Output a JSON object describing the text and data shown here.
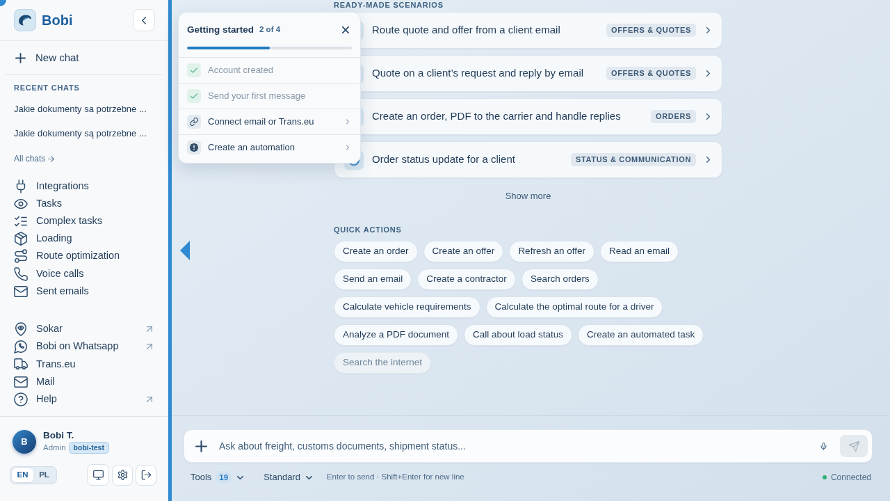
{
  "sidebar": {
    "brand": "Bobi",
    "new_chat": "New chat",
    "recent_heading": "RECENT CHATS",
    "recent_chats": [
      "Jakie dokumenty sa potrzebne ...",
      "Jakie dokumenty są potrzebne ..."
    ],
    "all_chats": "All chats",
    "nav": [
      {
        "label": "Integrations"
      },
      {
        "label": "Tasks"
      },
      {
        "label": "Complex tasks"
      },
      {
        "label": "Loading"
      },
      {
        "label": "Route optimization"
      },
      {
        "label": "Voice calls"
      },
      {
        "label": "Sent emails"
      }
    ],
    "links": [
      {
        "label": "Sokar",
        "external": true
      },
      {
        "label": "Bobi on Whatsapp",
        "external": true
      },
      {
        "label": "Trans.eu",
        "external": false
      },
      {
        "label": "Mail",
        "external": false
      },
      {
        "label": "Help",
        "external": true
      }
    ],
    "user": {
      "initial": "B",
      "name": "Bobi T.",
      "role": "Admin",
      "workspace": "bobi-test"
    },
    "languages": [
      {
        "label": "EN",
        "selected": true
      },
      {
        "label": "PL",
        "selected": false
      }
    ]
  },
  "onboarding": {
    "title": "Getting started",
    "progress": "2 of 4",
    "level": 0.5,
    "steps": [
      {
        "label": "Account created",
        "done": true
      },
      {
        "label": "Send your first message",
        "done": true
      },
      {
        "label": "Connect email or Trans.eu",
        "done": false
      },
      {
        "label": "Create an automation",
        "done": false
      }
    ]
  },
  "scenarios": {
    "heading": "READY-MADE SCENARIOS",
    "items": [
      {
        "title": "Route quote and offer from a client email",
        "tag": "OFFERS & QUOTES"
      },
      {
        "title": "Quote on a client’s request and reply by email",
        "tag": "OFFERS & QUOTES"
      },
      {
        "title": "Create an order, PDF to the carrier and handle replies",
        "tag": "ORDERS"
      },
      {
        "title": "Order status update for a client",
        "tag": "STATUS & COMMUNICATION"
      }
    ],
    "show_more": "Show more"
  },
  "quick_actions": {
    "heading": "QUICK ACTIONS",
    "items": [
      {
        "label": "Create an order",
        "disabled": false
      },
      {
        "label": "Create an offer",
        "disabled": false
      },
      {
        "label": "Refresh an offer",
        "disabled": false
      },
      {
        "label": "Read an email",
        "disabled": false
      },
      {
        "label": "Send an email",
        "disabled": false
      },
      {
        "label": "Create a contractor",
        "disabled": false
      },
      {
        "label": "Search orders",
        "disabled": false
      },
      {
        "label": "Calculate vehicle requirements",
        "disabled": false
      },
      {
        "label": "Calculate the optimal route for a driver",
        "disabled": false
      },
      {
        "label": "Analyze a PDF document",
        "disabled": false
      },
      {
        "label": "Call about load status",
        "disabled": false
      },
      {
        "label": "Create an automated task",
        "disabled": false
      },
      {
        "label": "Search the internet",
        "disabled": true
      }
    ]
  },
  "composer": {
    "placeholder": "Ask about freight, customs documents, shipment status...",
    "tools": "Tools",
    "tools_count": "19",
    "mode": "Standard",
    "hint": "Enter to send · Shift+Enter for new line",
    "status": "Connected",
    "online": true
  }
}
